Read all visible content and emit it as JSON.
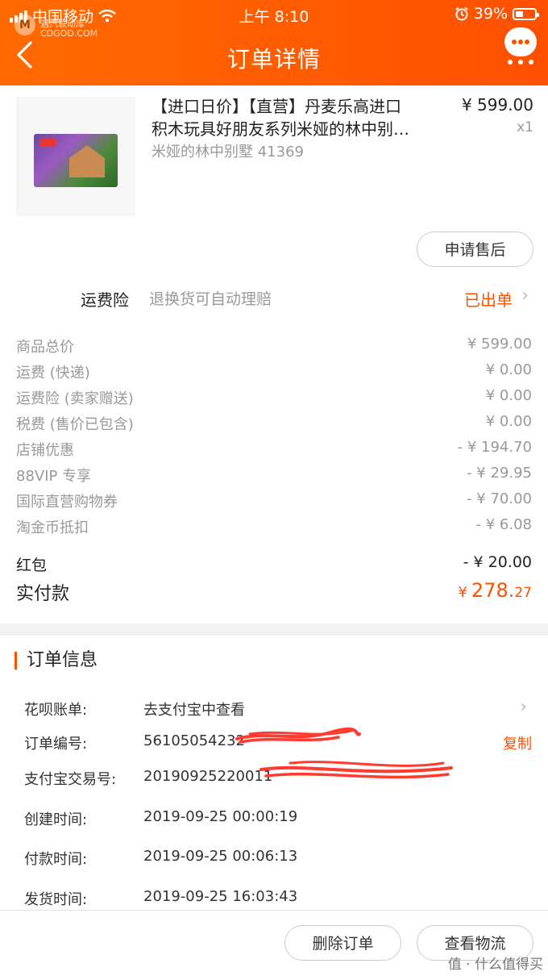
{
  "status_bar": {
    "carrier": "中国移动",
    "wifi_icon": "wifi-icon",
    "time": "上午 8:10",
    "alarm_icon": "alarm-icon",
    "battery": "39%",
    "battery_level": 0.39
  },
  "watermark": {
    "logo": "M",
    "line1": "遇汽联动库",
    "line2": "CDGOD.COM"
  },
  "header": {
    "title": "订单详情",
    "back_icon": "back-chevron-icon",
    "more_icon": "more-chat-icon"
  },
  "product": {
    "title_line1": "【进口日价】【直营】丹麦乐高进口",
    "title_line2": "积木玩具好朋友系列米娅的林中别…",
    "price": "¥ 599.00",
    "qty": "x1",
    "sku": "米娅的林中别墅 41369",
    "after_sale_btn": "申请售后"
  },
  "insurance": {
    "label": "运费险",
    "desc": "退换货可自动理赔",
    "status": "已出单"
  },
  "fees": [
    {
      "label": "商品总价",
      "value": "¥ 599.00"
    },
    {
      "label": "运费 (快递)",
      "value": "¥ 0.00"
    },
    {
      "label": "运费险 (卖家赠送)",
      "value": "¥ 0.00"
    },
    {
      "label": "税费 (售价已包含)",
      "value": "¥ 0.00"
    },
    {
      "label": "店铺优惠",
      "value": "- ¥ 194.70"
    },
    {
      "label": "88VIP 专享",
      "value": "- ¥ 29.95"
    },
    {
      "label": "国际直营购物券",
      "value": "- ¥ 70.00"
    },
    {
      "label": "淘金币抵扣",
      "value": "- ¥ 6.08"
    },
    {
      "label": "红包",
      "value": "- ¥ 20.00"
    }
  ],
  "total": {
    "label": "实付款",
    "currency": "¥",
    "int": "278.",
    "dec": "27"
  },
  "order_info": {
    "section_title": "订单信息",
    "rows": [
      {
        "label": "花呗账单:",
        "value": "去支付宝中查看",
        "action": ""
      },
      {
        "label": "订单编号:",
        "value": "56105054232",
        "action": "复制"
      },
      {
        "label": "支付宝交易号:",
        "value": "20190925220011",
        "action": ""
      },
      {
        "label": "创建时间:",
        "value": "2019-09-25 00:00:19",
        "action": ""
      },
      {
        "label": "付款时间:",
        "value": "2019-09-25 00:06:13",
        "action": ""
      },
      {
        "label": "发货时间:",
        "value": "2019-09-25 16:03:43",
        "action": ""
      }
    ]
  },
  "bottom": {
    "delete_btn": "删除订单",
    "logistics_btn": "查看物流",
    "watermark": "值 · 什么值得买"
  },
  "colors": {
    "accent": "#ff5000",
    "header_start": "#ff6a00",
    "scribble": "#ff3b30"
  }
}
